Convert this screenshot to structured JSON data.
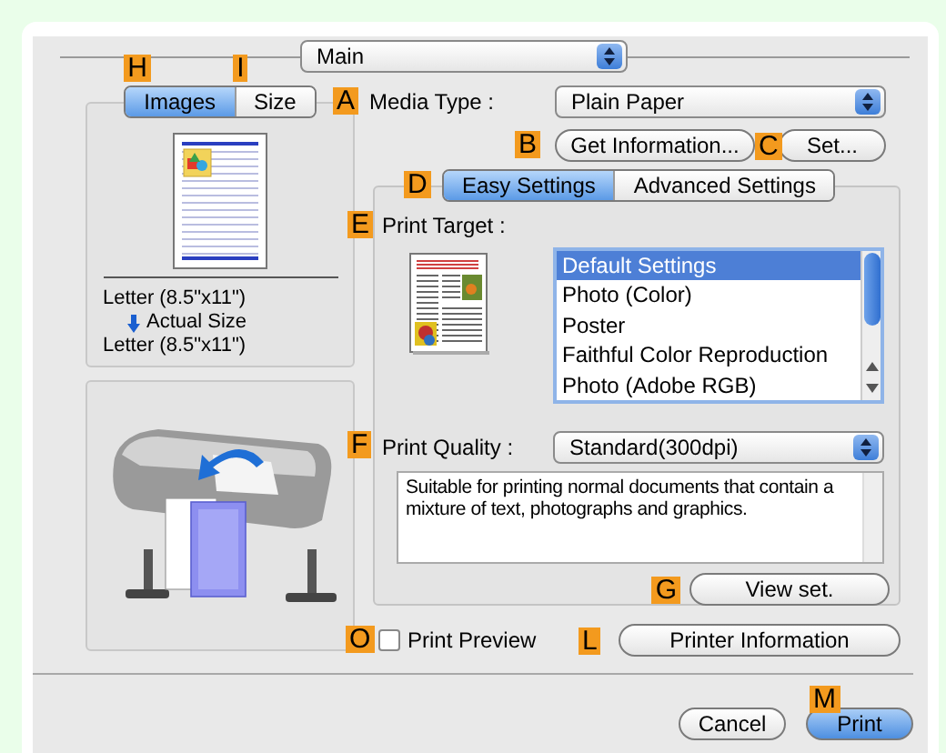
{
  "section_popup": {
    "value": "Main"
  },
  "preview_tabs": [
    {
      "label": "Images",
      "selected": true,
      "callout": "H"
    },
    {
      "label": "Size",
      "selected": false,
      "callout": "I"
    }
  ],
  "paper": {
    "source": "Letter (8.5\"x11\")",
    "mode": "Actual Size",
    "output": "Letter (8.5\"x11\")"
  },
  "media_type": {
    "callout": "A",
    "label": "Media Type :",
    "value": "Plain Paper"
  },
  "get_information": {
    "callout": "B",
    "label": "Get Information..."
  },
  "set": {
    "callout": "C",
    "label": "Set..."
  },
  "settings_tabs": {
    "callout": "D",
    "tabs": [
      {
        "label": "Easy Settings",
        "selected": true
      },
      {
        "label": "Advanced Settings",
        "selected": false
      }
    ]
  },
  "print_target": {
    "callout": "E",
    "label": "Print Target :",
    "options": [
      {
        "label": "Default Settings",
        "selected": true
      },
      {
        "label": "Photo (Color)",
        "selected": false
      },
      {
        "label": "Poster",
        "selected": false
      },
      {
        "label": "Faithful Color Reproduction",
        "selected": false
      },
      {
        "label": "Photo (Adobe RGB)",
        "selected": false
      }
    ]
  },
  "print_quality": {
    "callout": "F",
    "label": "Print Quality :",
    "value": "Standard(300dpi)",
    "description": "Suitable for printing normal documents that contain a mixture of text, photographs and graphics."
  },
  "view_set": {
    "callout": "G",
    "label": "View set."
  },
  "print_preview": {
    "callout": "O",
    "label": "Print Preview",
    "checked": false
  },
  "printer_information": {
    "callout": "L",
    "label": "Printer Information"
  },
  "buttons": [
    {
      "label": "Cancel",
      "kind": "cancel"
    },
    {
      "label": "Print",
      "kind": "default",
      "callout": "M"
    }
  ]
}
